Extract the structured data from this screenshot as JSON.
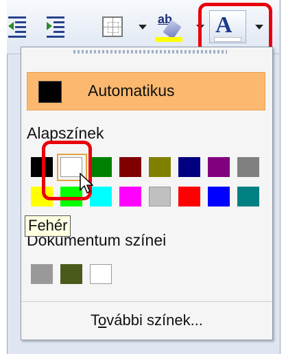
{
  "toolbar": {
    "icons": [
      "decrease-indent-icon",
      "increase-indent-icon",
      "table-borders-icon",
      "highlight-icon",
      "font-color-icon"
    ],
    "highlight_text": "ab",
    "colors": {
      "highlight": "#ffff00",
      "font_color_bar": "#ffffff",
      "accent_red": "#e8000b"
    }
  },
  "menu": {
    "automatic_label": "Automatikus",
    "basic_section": "Alapszínek",
    "document_section": "Dokumentum színei",
    "more_colors_prefix": "T",
    "more_colors_ul": "o",
    "more_colors_rest": "vábbi színek...",
    "basic_colors": [
      "#000000",
      "#ffffff",
      "#008000",
      "#800000",
      "#808000",
      "#000080",
      "#800080",
      "#808080",
      "#ffff00",
      "#00ff00",
      "#00ffff",
      "#ff00ff",
      "#c0c0c0",
      "#ff0000",
      "#0000ff",
      "#008080"
    ],
    "document_colors": [
      "#999999",
      "#4a5a1a",
      "#ffffff"
    ]
  },
  "tooltip": {
    "text": "Fehér"
  }
}
